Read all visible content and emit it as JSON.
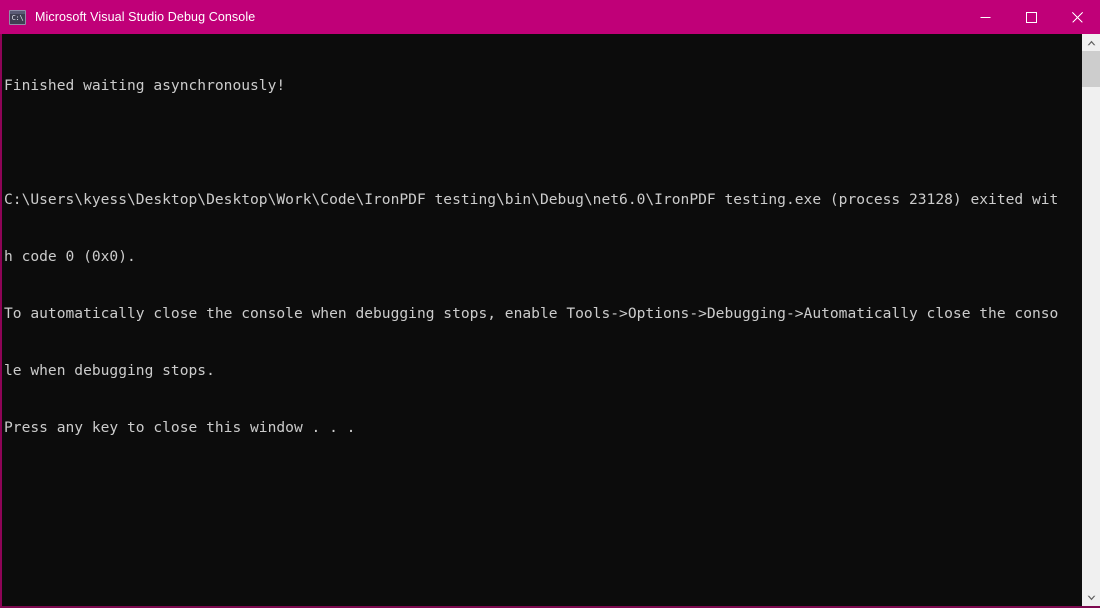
{
  "window": {
    "title": "Microsoft Visual Studio Debug Console",
    "icon_name": "console-app-icon",
    "icon_glyph": "C:\\",
    "titlebar_color": "#C00078",
    "console_background": "#0C0C0C",
    "console_foreground": "#CCCCCC",
    "border_color": "#8E0457"
  },
  "controls": {
    "minimize_label": "Minimize",
    "maximize_label": "Maximize",
    "close_label": "Close"
  },
  "console": {
    "lines": [
      "Finished waiting asynchronously!",
      "",
      "C:\\Users\\kyess\\Desktop\\Desktop\\Work\\Code\\IronPDF testing\\bin\\Debug\\net6.0\\IronPDF testing.exe (process 23128) exited wit",
      "h code 0 (0x0).",
      "To automatically close the console when debugging stops, enable Tools->Options->Debugging->Automatically close the conso",
      "le when debugging stops.",
      "Press any key to close this window . . ."
    ],
    "process_id": "23128",
    "exit_code": "0 (0x0)",
    "executable_path": "C:\\Users\\kyess\\Desktop\\Desktop\\Work\\Code\\IronPDF testing\\bin\\Debug\\net6.0\\IronPDF testing.exe",
    "prompt_text": "Press any key to close this window . . ."
  },
  "scrollbar": {
    "up_label": "Scroll up",
    "down_label": "Scroll down",
    "thumb_label": "Scroll thumb",
    "track_color": "#F0F0F0",
    "thumb_color": "#CDCDCD"
  }
}
